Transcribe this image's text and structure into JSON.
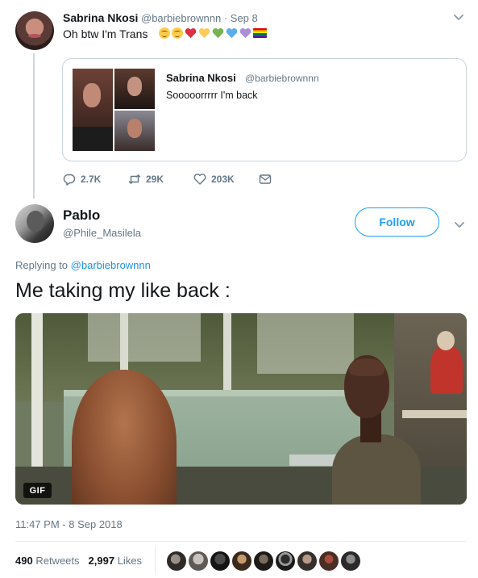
{
  "parent_tweet": {
    "name": "Sabrina Nkosi",
    "handle_date": "@barbiebrownnn · Sep 8",
    "text": "Oh btw I'm Trans",
    "emojis": [
      "smiling-face-icon",
      "winking-face-icon",
      "red-heart-icon",
      "yellow-heart-icon",
      "green-heart-icon",
      "blue-heart-icon",
      "purple-heart-icon",
      "rainbow-flag-icon"
    ],
    "quote": {
      "name": "Sabrina Nkosi",
      "handle": "@barbiebrownnn",
      "text": "Sooooorrrrr I'm back"
    },
    "actions": {
      "replies": "2.7K",
      "retweets": "29K",
      "likes": "203K"
    }
  },
  "main_tweet": {
    "name": "Pablo",
    "handle": "@Phile_Masilela",
    "follow_label": "Follow",
    "replying_prefix": "Replying to",
    "replying_to": "@barbiebrownnn",
    "text": "Me taking my like back :",
    "media_badge": "GIF",
    "timestamp": "11:47 PM - 8 Sep 2018",
    "retweets_count": "490",
    "retweets_label": "Retweets",
    "likes_count": "2,997",
    "likes_label": "Likes"
  },
  "colors": {
    "accent": "#1da1f2",
    "muted": "#657786",
    "text": "#14171a",
    "border": "#ccd6dd"
  }
}
